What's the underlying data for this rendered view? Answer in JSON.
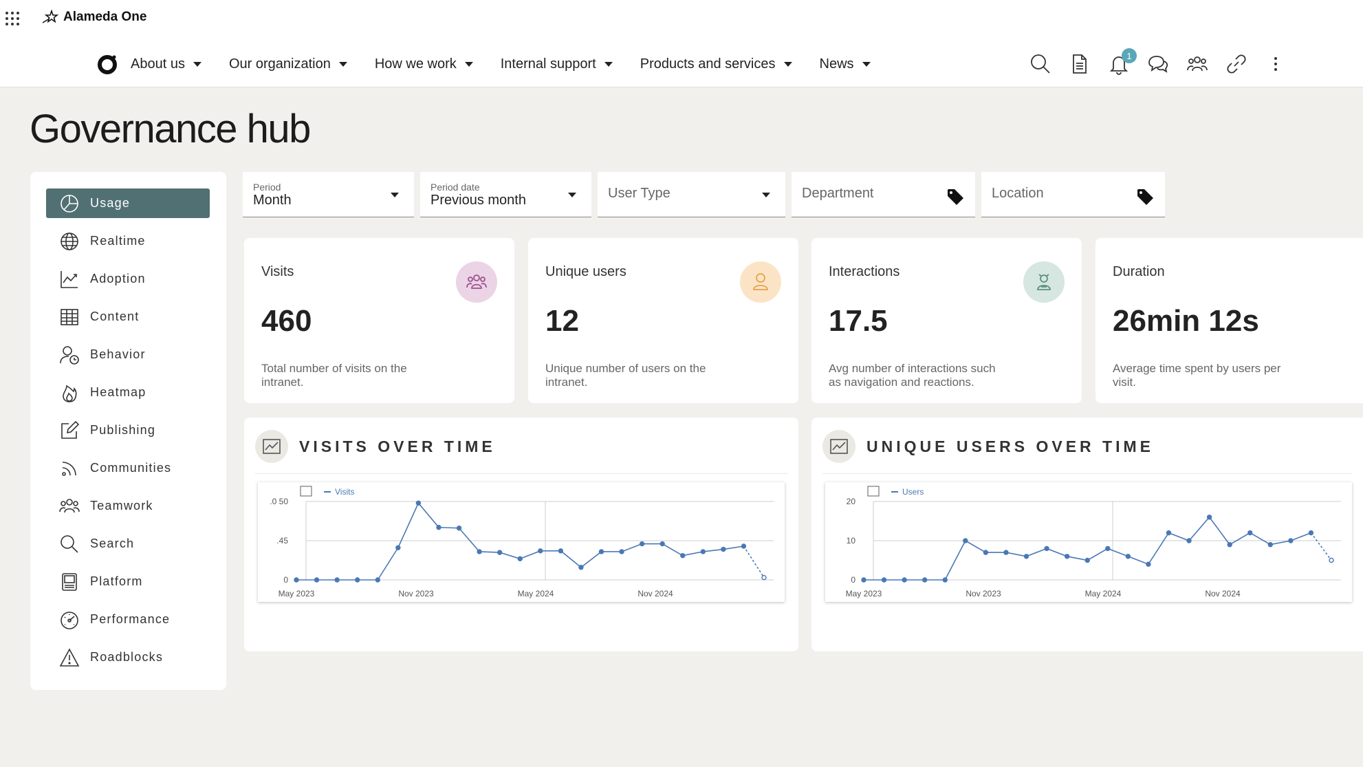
{
  "app": {
    "brand": "Alameda One"
  },
  "nav": {
    "items": [
      {
        "label": "About us"
      },
      {
        "label": "Our organization"
      },
      {
        "label": "How we work"
      },
      {
        "label": "Internal support"
      },
      {
        "label": "Products and services"
      },
      {
        "label": "News"
      }
    ]
  },
  "toolbar": {
    "notification_count": "1"
  },
  "page": {
    "title": "Governance hub"
  },
  "sidebar": {
    "items": [
      {
        "label": "Usage",
        "icon": "pie-chart-icon",
        "active": true
      },
      {
        "label": "Realtime",
        "icon": "globe-icon"
      },
      {
        "label": "Adoption",
        "icon": "trend-chart-icon"
      },
      {
        "label": "Content",
        "icon": "table-icon"
      },
      {
        "label": "Behavior",
        "icon": "user-clock-icon"
      },
      {
        "label": "Heatmap",
        "icon": "flame-icon"
      },
      {
        "label": "Publishing",
        "icon": "edit-icon"
      },
      {
        "label": "Communities",
        "icon": "rss-icon"
      },
      {
        "label": "Teamwork",
        "icon": "team-icon"
      },
      {
        "label": "Search",
        "icon": "search-icon"
      },
      {
        "label": "Platform",
        "icon": "server-icon"
      },
      {
        "label": "Performance",
        "icon": "gauge-icon"
      },
      {
        "label": "Roadblocks",
        "icon": "warning-icon"
      }
    ]
  },
  "filters": {
    "period": {
      "label": "Period",
      "value": "Month"
    },
    "period_date": {
      "label": "Period date",
      "value": "Previous month"
    },
    "user_type": {
      "placeholder": "User Type"
    },
    "department": {
      "placeholder": "Department"
    },
    "location": {
      "placeholder": "Location"
    }
  },
  "kpis": [
    {
      "title": "Visits",
      "value": "460",
      "description": "Total number of visits on the intranet.",
      "icon": "users-group-icon",
      "icon_color": "#a04f8e",
      "icon_bg": "#ead4e6"
    },
    {
      "title": "Unique users",
      "value": "12",
      "description": "Unique number of users on the intranet.",
      "icon": "user-icon",
      "icon_color": "#e8a24a",
      "icon_bg": "#fbe4c6"
    },
    {
      "title": "Interactions",
      "value": "17.5",
      "description": "Avg number of interactions such as navigation and reactions.",
      "icon": "user-interaction-icon",
      "icon_color": "#5c8f80",
      "icon_bg": "#d6e6e1"
    },
    {
      "title": "Duration",
      "value": "26min 12s",
      "description": "Average time spent by users per visit."
    }
  ],
  "panels": [
    {
      "title": "VISITS OVER TIME"
    },
    {
      "title": "UNIQUE USERS OVER TIME"
    }
  ],
  "chart_data": [
    {
      "type": "line",
      "title": "VISITS OVER TIME",
      "x_ticks": [
        "May 2023",
        "Nov 2023",
        "May 2024",
        "Nov 2024"
      ],
      "y_ticks": [
        ".0 50",
        ".45",
        "0"
      ],
      "ylim": [
        0,
        0.1
      ],
      "series": [
        {
          "name": "Visits",
          "color": "#4a78b5",
          "values": [
            0,
            0,
            0,
            0,
            0,
            0.041,
            0.098,
            0.067,
            0.066,
            0.036,
            0.035,
            0.027,
            0.037,
            0.037,
            0.016,
            0.036,
            0.036,
            0.046,
            0.046,
            0.031,
            0.036,
            0.039,
            0.043,
            0.003
          ],
          "last_segment_dashed": true
        }
      ]
    },
    {
      "type": "line",
      "title": "UNIQUE USERS OVER TIME",
      "x_ticks": [
        "May 2023",
        "Nov 2023",
        "May 2024",
        "Nov 2024"
      ],
      "y_ticks": [
        "20",
        "10",
        "0"
      ],
      "ylim": [
        0,
        20
      ],
      "series": [
        {
          "name": "Users",
          "color": "#4a78b5",
          "values": [
            0,
            0,
            0,
            0,
            0,
            10,
            7,
            7,
            6,
            8,
            6,
            5,
            8,
            6,
            4,
            12,
            10,
            16,
            9,
            12,
            9,
            10,
            12,
            5
          ],
          "last_segment_dashed": true
        }
      ]
    }
  ]
}
